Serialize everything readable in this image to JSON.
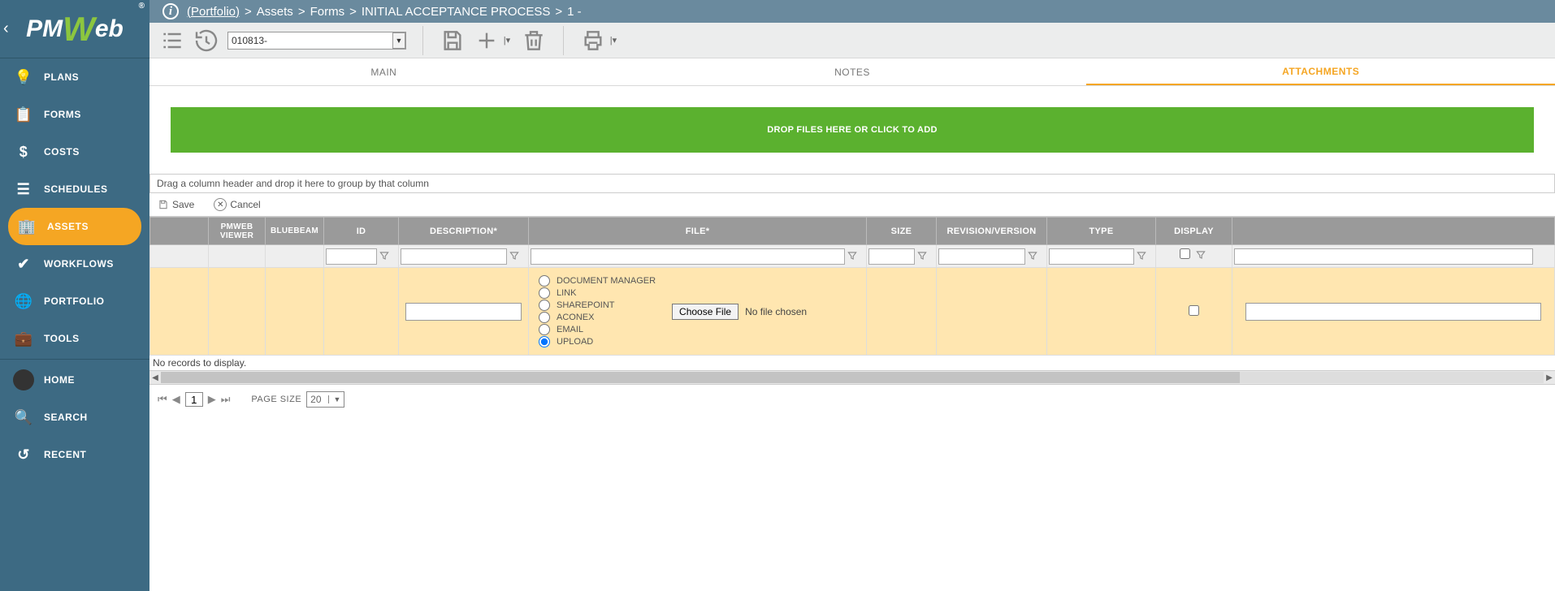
{
  "breadcrumb": {
    "root": "(Portfolio)",
    "parts": [
      "Assets",
      "Forms",
      "INITIAL ACCEPTANCE PROCESS",
      "1 -"
    ]
  },
  "logo_text_pm": "PM",
  "logo_text_w": "W",
  "logo_text_eb": "eb",
  "sidebar": {
    "items": [
      {
        "label": "PLANS",
        "icon": "lightbulb-icon"
      },
      {
        "label": "FORMS",
        "icon": "clipboard-icon"
      },
      {
        "label": "COSTS",
        "icon": "dollar-icon"
      },
      {
        "label": "SCHEDULES",
        "icon": "bars-icon"
      },
      {
        "label": "ASSETS",
        "icon": "building-icon",
        "active": true
      },
      {
        "label": "WORKFLOWS",
        "icon": "check-icon"
      },
      {
        "label": "PORTFOLIO",
        "icon": "globe-icon"
      },
      {
        "label": "TOOLS",
        "icon": "briefcase-icon"
      }
    ],
    "home": "HOME",
    "search": "SEARCH",
    "recent": "RECENT"
  },
  "toolbar": {
    "record_dd": "010813-"
  },
  "tabs": {
    "main": "MAIN",
    "notes": "NOTES",
    "attachments": "ATTACHMENTS"
  },
  "dropzone": "DROP FILES HERE OR CLICK TO ADD",
  "groupbar": "Drag a column header and drop it here to group by that column",
  "editbar": {
    "save": "Save",
    "cancel": "Cancel"
  },
  "columns": {
    "pmweb_viewer": "PMWEB VIEWER",
    "bluebeam": "BLUEBEAM",
    "id": "ID",
    "description": "DESCRIPTION*",
    "file": "FILE*",
    "size": "SIZE",
    "revision": "REVISION/VERSION",
    "type": "TYPE",
    "display": "DISPLAY"
  },
  "file_options": {
    "doc_manager": "DOCUMENT MANAGER",
    "link": "LINK",
    "sharepoint": "SHAREPOINT",
    "aconex": "ACONEX",
    "email": "EMAIL",
    "upload": "UPLOAD"
  },
  "choose_file_btn": "Choose File",
  "no_file_chosen": "No file chosen",
  "no_records": "No records to display.",
  "pager": {
    "page": "1",
    "page_size_label": "PAGE SIZE",
    "page_size": "20"
  }
}
